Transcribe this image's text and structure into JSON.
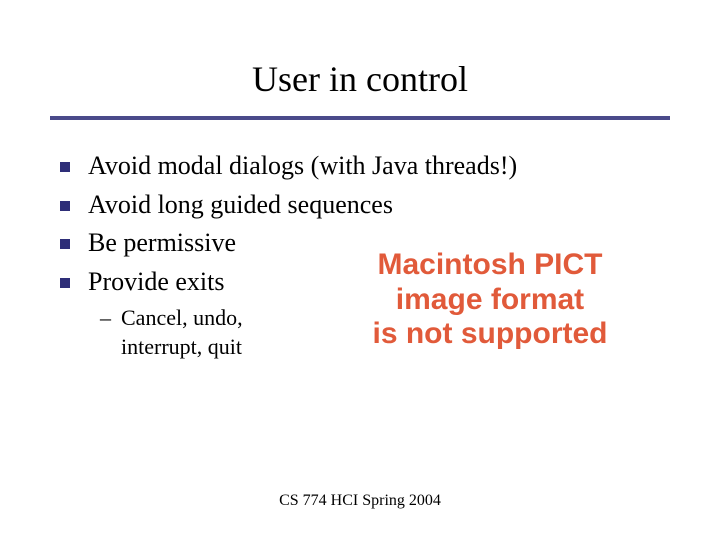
{
  "title": "User in control",
  "bullets": [
    "Avoid modal dialogs (with Java threads!)",
    "Avoid long guided sequences",
    "Be permissive",
    "Provide exits"
  ],
  "sub_bullet": "Cancel, undo, interrupt, quit",
  "placeholder_lines": [
    "Macintosh PICT",
    "image format",
    "is not supported"
  ],
  "footer": "CS 774 HCI Spring 2004",
  "colors": {
    "rule": "#4a4a8a",
    "bullet_square": "#2e2e78",
    "placeholder_text": "#e15a3a"
  }
}
